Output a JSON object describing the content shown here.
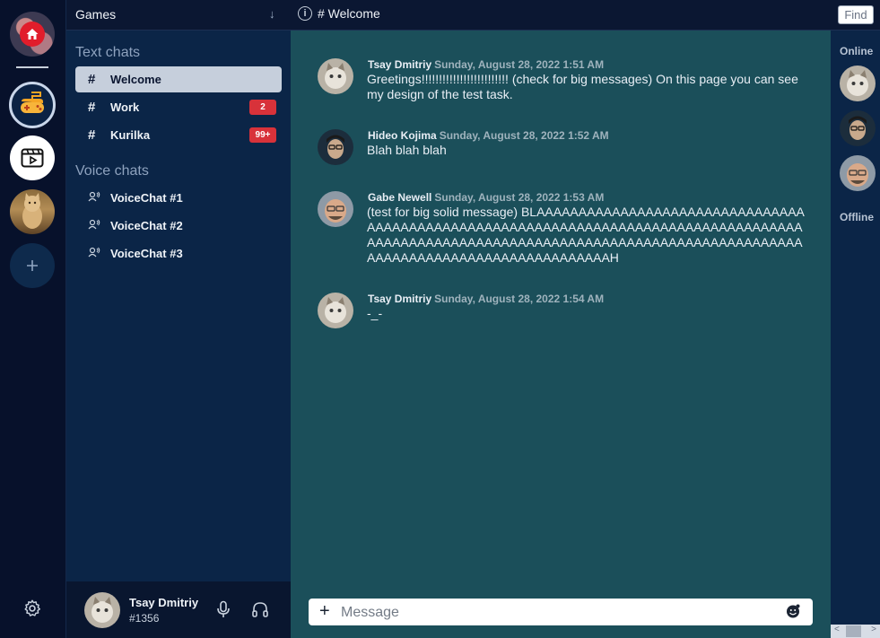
{
  "topbar": {
    "server_name": "Games",
    "channel_title": "# Welcome",
    "find_label": "Find"
  },
  "channels": {
    "text_title": "Text chats",
    "voice_title": "Voice chats",
    "text": [
      {
        "label": "Welcome",
        "badge": ""
      },
      {
        "label": "Work",
        "badge": "2"
      },
      {
        "label": "Kurilka",
        "badge": "99+"
      }
    ],
    "voice": [
      {
        "label": "VoiceChat #1"
      },
      {
        "label": "VoiceChat #2"
      },
      {
        "label": "VoiceChat #3"
      }
    ]
  },
  "user": {
    "name": "Tsay Dmitriy",
    "tag": "#1356"
  },
  "messages": [
    {
      "author": "Tsay Dmitriy",
      "time": "Sunday, August 28, 2022 1:51 AM",
      "text": "Greetings!!!!!!!!!!!!!!!!!!!!!!!!! (check for big messages) On this page you can see my design of the test task."
    },
    {
      "author": "Hideo Kojima",
      "time": "Sunday, August 28, 2022 1:52 AM",
      "text": "Blah blah blah"
    },
    {
      "author": "Gabe Newell",
      "time": "Sunday, August 28, 2022 1:53 AM",
      "text": "(test for big solid message) BLAAAAAAAAAAAAAAAAAAAAAAAAAAAAAAAAAAAAAAAAAAAAAAAAAAAAAAAAAAAAAAAAAAAAAAAAAAAAAAAAAAAAAAAAAAAAAAAAAAAAAAAAAAAAAAAAAAAAAAAAAAAAAAAAAAAAAAAAAAAAAAAAAAAAAAAAAAAAAAAAAAAAAH"
    },
    {
      "author": "Tsay Dmitriy",
      "time": "Sunday, August 28, 2022 1:54 AM",
      "text": "-_-"
    }
  ],
  "composer": {
    "placeholder": "Message"
  },
  "members": {
    "online_title": "Online",
    "offline_title": "Offline"
  },
  "icons": {
    "home": "home-icon",
    "games_server": "gamepad-icon",
    "video_server": "video-icon",
    "add_server": "plus-icon",
    "settings": "gear-icon",
    "mic": "microphone-icon",
    "headset": "headphones-icon",
    "emoji": "emoji-icon"
  },
  "colors": {
    "chat_bg": "#1b4f5a",
    "sidebar_bg": "#0b2547",
    "rail_bg": "#07112b",
    "badge": "#d8323a",
    "home_red": "#e11d2b",
    "active_channel": "#c6cfdc"
  }
}
